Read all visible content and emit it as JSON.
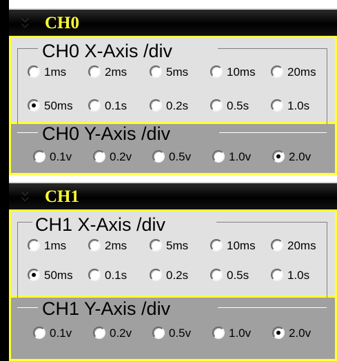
{
  "channels": [
    {
      "title": "CH0",
      "x_axis": {
        "legend": "CH0 X-Axis /div",
        "options": [
          "1ms",
          "2ms",
          "5ms",
          "10ms",
          "20ms",
          "50ms",
          "0.1s",
          "0.2s",
          "0.5s",
          "1.0s"
        ],
        "selected": "50ms"
      },
      "y_axis": {
        "legend": "CH0 Y-Axis /div",
        "options": [
          "0.1v",
          "0.2v",
          "0.5v",
          "1.0v",
          "2.0v"
        ],
        "selected": "2.0v"
      }
    },
    {
      "title": "CH1",
      "x_axis": {
        "legend": "CH1 X-Axis /div",
        "options": [
          "1ms",
          "2ms",
          "5ms",
          "10ms",
          "20ms",
          "50ms",
          "0.1s",
          "0.2s",
          "0.5s",
          "1.0s"
        ],
        "selected": "50ms"
      },
      "y_axis": {
        "legend": "CH1 Y-Axis /div",
        "options": [
          "0.1v",
          "0.2v",
          "0.5v",
          "1.0v",
          "2.0v"
        ],
        "selected": "2.0v"
      }
    }
  ]
}
